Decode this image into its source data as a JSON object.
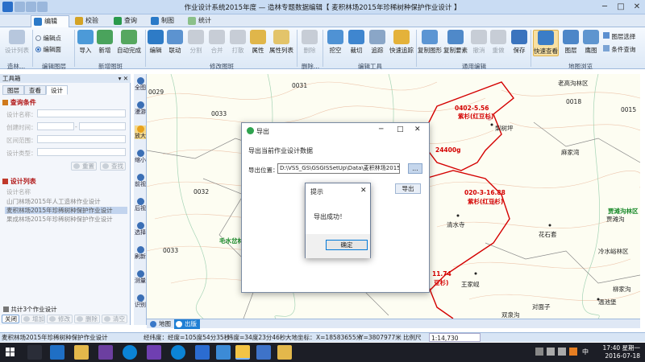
{
  "window": {
    "title": "作业设计系统2015年度 — 造林专题数据编辑【 麦积林场2015年珍稀树种保护作业设计 】",
    "min_glyph": "─",
    "max_glyph": "□",
    "close_glyph": "✕"
  },
  "tabs": [
    "编辑",
    "校验",
    "查询",
    "制图",
    "统计"
  ],
  "active_tab": "编辑",
  "ribbon": {
    "left_buttons": [
      "设计列表",
      "编辑点",
      "编辑面"
    ],
    "add_buttons": [
      "导入",
      "新增",
      "自动完成"
    ],
    "edit_buttons": [
      "编辑",
      "联动",
      "分割",
      "合并",
      "打散",
      "属性",
      "属性列表"
    ],
    "delete_buttons": [
      "删除"
    ],
    "tool_buttons": [
      "挖空",
      "裁切",
      "追踪",
      "快速追踪"
    ],
    "common_buttons": [
      "复制图形",
      "复制要素",
      "撤消",
      "重做",
      "保存"
    ],
    "view_buttons": [
      "快速查看",
      "图层",
      "鹰图"
    ],
    "right_buttons": [
      "图层选择",
      "条件查询"
    ],
    "groups": [
      "造林...",
      "编辑图层",
      "新增图斑",
      "修改图斑",
      "删除...",
      "编辑工具",
      "通用编辑",
      "地图浏览"
    ]
  },
  "toolbox": {
    "title": "工具箱",
    "pin": "▾ ✕",
    "tabs": [
      "图层",
      "查看",
      "设计"
    ],
    "active_tab": "设计",
    "query_section": "查询条件",
    "fields": {
      "design_name": "设计名称：",
      "created_time": "创建时间：",
      "area_range": "区间范围：",
      "design_type": "设计类型："
    },
    "reset_btn": "重置",
    "search_btn": "查找",
    "list_section": "设计列表",
    "list_header": "设计名称",
    "items": [
      "山门林场2015年人工造林作业设计",
      "麦积林场2015年珍稀树种保护作业设计",
      "果成林场2015年珍稀树种保护作业设计"
    ],
    "selected_index": 1,
    "count_text": "共计3个作业设计",
    "bottom_buttons": [
      "关闭",
      "增加",
      "修改",
      "删除",
      "清空"
    ]
  },
  "side_tools": [
    "全图",
    "漫游",
    "放大",
    "缩小",
    "前视",
    "后视",
    "选择",
    "刷新",
    "测量",
    "识别"
  ],
  "map": {
    "labels": [
      "0029",
      "0032",
      "0033",
      "0031",
      "0018",
      "0015",
      "0033"
    ],
    "places": [
      "梨树坪",
      "麻家湾",
      "清水寺",
      "花石套",
      "王家岘",
      "双泉沟",
      "对面子",
      "温池堡",
      "冷水峪林区",
      "贾滩沟",
      "柳家沟",
      "老高沟林区"
    ],
    "red_labels": [
      "0402-5.56",
      "紫杉(红豆杉)",
      "24400g",
      "020-3-16.88",
      "紫杉(红豆杉)",
      "11.74",
      "豆杉)"
    ],
    "green_labels": [
      "毛水岔林区",
      "贾滩沟林区"
    ]
  },
  "map_tabs": [
    "地图",
    "出版"
  ],
  "active_map_tab": "地图",
  "status": {
    "project": "麦积林场2015年珍稀树种保护作业设计",
    "coords_label": "经纬度：",
    "lon": "经度=105度54分35秒",
    "lat": "纬度=34度23分46秒",
    "geo_label": "大地坐标：",
    "x": "X=18583655米",
    "y": "Y=3807977米",
    "scale_label": "比例尺",
    "scale": "1:14,730"
  },
  "export_dialog": {
    "title": "导出",
    "heading": "导出当前作业设计数据",
    "path_label": "导出位置：",
    "path_value": "D:\\VSS_GS\\GSGISSetUp\\Data\\麦积林场2015年",
    "browse": "...",
    "export_btn": "导出",
    "min": "─",
    "max": "□",
    "close": "✕"
  },
  "prompt_dialog": {
    "title": "提示",
    "message": "导出成功！",
    "ok": "确定",
    "close": "✕"
  },
  "taskbar": {
    "time": "17:40 星期一",
    "date": "2016-07-18",
    "lang": "中"
  },
  "colors": {
    "accent": "#1f7fd4",
    "boundary": "#d40000",
    "forest_label": "#1a8a2a",
    "taskbar": "#1c1e26"
  }
}
